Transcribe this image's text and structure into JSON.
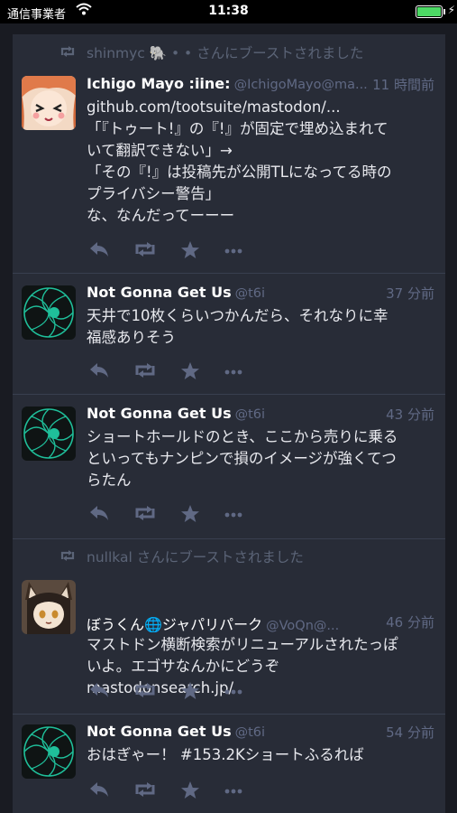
{
  "statusbar": {
    "carrier": "通信事業者",
    "time": "11:38",
    "icons": [
      "wifi-icon",
      "battery-icon",
      "charging-bolt-icon"
    ]
  },
  "colors": {
    "background": "#191b22",
    "card": "#282c37",
    "muted": "#606984",
    "battery": "#4cd964"
  },
  "statuses": [
    {
      "boost": {
        "by": "shinmyc 🐘 • • さんにブーストされました"
      },
      "display_name": "Ichigo Mayo :iine:",
      "acct": "@IchigoMayo@ma...",
      "time": "11 時間前",
      "lines": [
        "github.com/tootsuite/mastodon/...",
        "「『トゥート!』の『!』が固定で埋め込まれて",
        "いて翻訳できない」→",
        "「その『!』は投稿先が公開TLになってる時の",
        "プライバシー警告」",
        "な、なんだってーーー"
      ]
    },
    {
      "display_name": "Not Gonna Get Us",
      "acct": "@t6i",
      "time": "37 分前",
      "lines": [
        "天井で10枚くらいつかんだら、それなりに幸",
        "福感ありそう"
      ]
    },
    {
      "display_name": "Not Gonna Get Us",
      "acct": "@t6i",
      "time": "43 分前",
      "lines": [
        "ショートホールドのとき、ここから売りに乗る",
        "といってもナンピンで損のイメージが強くてつ",
        "らたん"
      ]
    },
    {
      "boost": {
        "by": "nullkal さんにブーストされました"
      },
      "display_name": "ぼうくん🌐ジャパリパーク",
      "acct": "@VoQn@...",
      "time": "46 分前",
      "lines": [
        "マストドン横断検索がリニューアルされたっぽ",
        "いよ。エゴサなんかにどうぞ",
        "mastodonsearch.jp/"
      ]
    },
    {
      "display_name": "Not Gonna Get Us",
      "acct": "@t6i",
      "time": "54 分前",
      "lines": [
        "おはぎゃー！ #153.2Kショートふるれば"
      ]
    }
  ]
}
